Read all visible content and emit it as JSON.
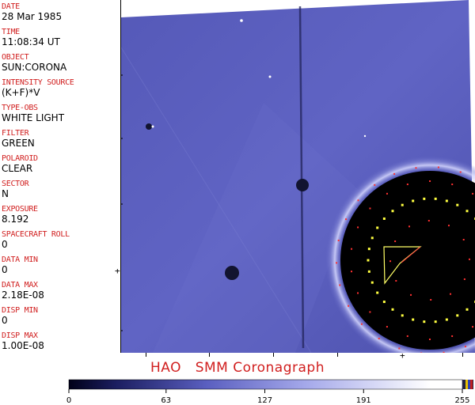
{
  "header_fields": [
    {
      "label": "DATE",
      "value": "28 Mar 1985"
    },
    {
      "label": "TIME",
      "value": "11:08:34 UT"
    },
    {
      "label": "OBJECT",
      "value": "SUN:CORONA"
    },
    {
      "label": "INTENSITY SOURCE",
      "value": "(K+F)*V"
    },
    {
      "label": "TYPE-OBS",
      "value": "WHITE LIGHT"
    },
    {
      "label": "FILTER",
      "value": "GREEN"
    },
    {
      "label": "POLAROID",
      "value": "CLEAR"
    },
    {
      "label": "SECTOR",
      "value": "N"
    },
    {
      "label": "EXPOSURE",
      "value": "8.192"
    },
    {
      "label": "SPACECRAFT ROLL",
      "value": "0"
    },
    {
      "label": "DATA MIN",
      "value": "0"
    },
    {
      "label": "DATA MAX",
      "value": "2.18E-08"
    },
    {
      "label": "DISP MIN",
      "value": "0"
    },
    {
      "label": "DISP MAX",
      "value": "1.00E-08"
    }
  ],
  "image_title": "HAO   SMM Coronagraph",
  "colorbar": {
    "ticks": [
      "0",
      "63",
      "127",
      "191",
      "255"
    ],
    "min": 0,
    "max": 255,
    "colors": {
      "dark": "#000018",
      "mid": "#5a5fc0",
      "light": "#ffffff"
    }
  },
  "colors": {
    "label": "#d12020",
    "accent": "#d12020"
  }
}
